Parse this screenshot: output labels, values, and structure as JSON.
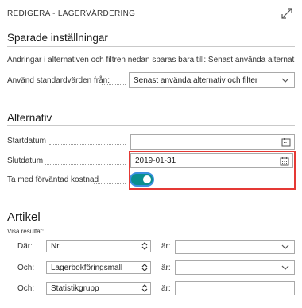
{
  "header": {
    "title": "REDIGERA - LAGERVÄRDERING",
    "expand_icon": "expand-arrows-icon"
  },
  "saved_settings": {
    "title": "Sparade inställningar",
    "info": "Ändringar i alternativen och filtren nedan sparas bara till: Senast använda alternativ och filter",
    "use_defaults_label": "Använd standardvärden från:",
    "use_defaults_value": "Senast använda alternativ och filter"
  },
  "options": {
    "title": "Alternativ",
    "start_date_label": "Startdatum",
    "start_date_value": "",
    "end_date_label": "Slutdatum",
    "end_date_value": "2019-01-31",
    "expected_cost_label": "Ta med förväntad kostnad",
    "expected_cost_on": true
  },
  "article": {
    "title": "Artikel",
    "show_results_label": "Visa resultat:",
    "filters": [
      {
        "prefix": "Där:",
        "field": "Nr",
        "is_label": "är:",
        "value": ""
      },
      {
        "prefix": "Och:",
        "field": "Lagerbokföringsmall",
        "is_label": "är:",
        "value": ""
      },
      {
        "prefix": "Och:",
        "field": "Statistikgrupp",
        "is_label": "är:",
        "value": ""
      }
    ]
  },
  "colors": {
    "highlight": "#e53935",
    "toggle_on": "#0a8f8f",
    "focus": "#3b8fe0"
  }
}
